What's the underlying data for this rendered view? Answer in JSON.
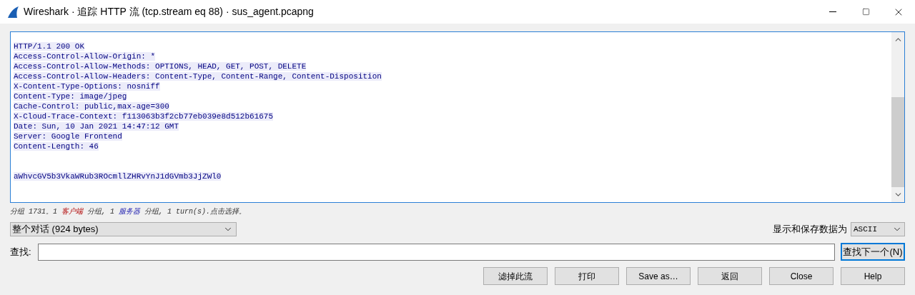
{
  "window": {
    "title": "Wireshark · 追踪 HTTP 流 (tcp.stream eq 88) · sus_agent.pcapng"
  },
  "stream": {
    "from_server": true,
    "headers": [
      "HTTP/1.1 200 OK",
      "Access-Control-Allow-Origin: *",
      "Access-Control-Allow-Methods: OPTIONS, HEAD, GET, POST, DELETE",
      "Access-Control-Allow-Headers: Content-Type, Content-Range, Content-Disposition",
      "X-Content-Type-Options: nosniff",
      "Content-Type: image/jpeg",
      "Cache-Control: public,max-age=300",
      "X-Cloud-Trace-Context: f113063b3f2cb77eb039e8d512b61675",
      "Date: Sun, 10 Jan 2021 14:47:12 GMT",
      "Server: Google Frontend",
      "Content-Length: 46"
    ],
    "body": "aWhvcGV5b3VkaWRub3ROcmllZHRvYnJ1dGVmb3JjZWl0"
  },
  "status_parts": [
    {
      "kind": "text",
      "text": "分组 1731。1 "
    },
    {
      "kind": "client",
      "text": "客户端"
    },
    {
      "kind": "text",
      "text": " 分组, 1 "
    },
    {
      "kind": "server",
      "text": "服务器"
    },
    {
      "kind": "text",
      "text": " 分组, 1 turn(s).点击选择。"
    }
  ],
  "conversation_select": {
    "value": "整个对话 (924 bytes)"
  },
  "format": {
    "label": "显示和保存数据为",
    "value": "ASCII"
  },
  "find": {
    "label": "查找:",
    "button": "查找下一个(N)"
  },
  "buttons": [
    "滤掉此流",
    "打印",
    "Save as…",
    "返回",
    "Close",
    "Help"
  ]
}
